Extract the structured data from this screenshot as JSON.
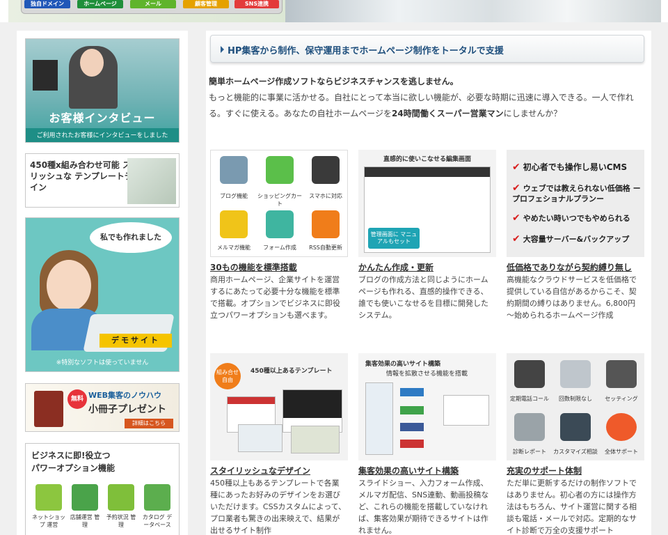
{
  "top_nav": {
    "buttons": [
      {
        "label": "独自ドメイン",
        "color": "#2057b8"
      },
      {
        "label": "ホームページ",
        "color": "#1f8f3a"
      },
      {
        "label": "メール",
        "color": "#5fb42c"
      },
      {
        "label": "顧客管理",
        "color": "#e5a100"
      },
      {
        "label": "SNS連携",
        "color": "#e33b3b"
      }
    ]
  },
  "sidebar": {
    "interview": {
      "title": "お客様インタビュー",
      "subtitle": "ご利用されたお客様にインタビューをしました"
    },
    "templates": {
      "text": "450種x組み合わせ可能 スタイリッシュな テンプレートデザイン"
    },
    "demo": {
      "speech": "私でも作れました",
      "button": "デモサイト",
      "note": "※特別なソフトは使っていません"
    },
    "booklet": {
      "badge": "無料",
      "line1": "WEB集客のノウハウ",
      "line2": "小冊子プレゼント",
      "more": "詳細はこちら"
    },
    "options": {
      "title_line1": "ビジネスに即!役立つ",
      "title_line2": "パワーオプション機能",
      "items": [
        {
          "label": "ネットショップ 運営",
          "color": "#8cc63f"
        },
        {
          "label": "店舗運営 管理",
          "color": "#4aa34a"
        },
        {
          "label": "予約状況 管理",
          "color": "#7fbf3a"
        },
        {
          "label": "カタログ データベース",
          "color": "#5cae4e"
        }
      ]
    }
  },
  "main": {
    "headline": "HP集客から制作、保守運用までホームページ制作をトータルで支援",
    "intro": {
      "lead": "簡単ホームページ作成ソフトならビジネスチャンスを逃しません。",
      "body1": "もっと機能的に事業に活かせる。自社にとって本当に欲しい機能が、必要な時期に迅速に導入できる。一人で作れる。すぐに使える。あなたの自社ホームページを",
      "emph": "24時間働くスーパー営業マン",
      "body2": "にしませんか？"
    },
    "features": {
      "icons": [
        {
          "label": "ブログ機能",
          "color": "#7a9ab0"
        },
        {
          "label": "ショッピングカート",
          "color": "#5bbf4a"
        },
        {
          "label": "スマホに対応",
          "color": "#3a3a3a"
        },
        {
          "label": "メルマガ機能",
          "color": "#f0c419"
        },
        {
          "label": "フォーム作成",
          "color": "#3fb5a0"
        },
        {
          "label": "RSS自動更新",
          "color": "#f07d1a"
        }
      ],
      "title": "30もの機能を標準搭載",
      "desc": "商用ホームページ、企業サイトを運営するにあたって必要十分な機能を標準で搭載。オプションでビジネスに即役立つパワーオプションも選べます。"
    },
    "editor": {
      "caption": "直感的に使いこなせる編集画面",
      "badge": "管理画面に マニュアルもセット",
      "title": "かんたん作成・更新",
      "desc": "ブログの作成方法と同じようにホームページも作れる、直感的操作できる、誰でも使いこなせるを目標に開発したシステム。"
    },
    "price": {
      "checks": [
        "初心者でも操作し易いCMS",
        "ウェブでは教えられない低価格 ープロフェショナルプランー",
        "やめたい時いつでもやめられる",
        "大容量サーバー&バックアップ"
      ],
      "title": "低価格でありながら契約縛り無し",
      "desc": "高機能なクラウドサービスを低価格で提供している自信があるからこそ、契約期間の縛りはありません。6,800円～始められるホームページ作成"
    },
    "design": {
      "badge": "組み合せ 自由",
      "caption": "450種以上あるテンプレート",
      "title": "スタイリッシュなデザイン",
      "desc": "450種以上もあるテンプレートで各業種にあったお好みのデザインをお選びいただけます。CSSカスタムによって、プロ業者も驚きの出来映えで、結果が出せるサイト制作"
    },
    "marketing": {
      "caption": "集客効果の高いサイト構築",
      "subcaption": "情報を拡散させる機能を搭載",
      "title": "集客効果の高いサイト構築",
      "desc": "スライドショー、入力フォーム作成、メルマガ配信、SNS連動、動画投稿など、これらの機能を搭載していなければ、集客効果が期待できるサイトは作れません。"
    },
    "support": {
      "icons": [
        {
          "label": "定期電話コール",
          "color": "#444"
        },
        {
          "label": "回数制限なし",
          "color": "#bfc6cc"
        },
        {
          "label": "セッティング",
          "color": "#555"
        },
        {
          "label": "診断レポート",
          "color": "#9aa3a8"
        },
        {
          "label": "カスタマイズ相談",
          "color": "#3b4a56"
        },
        {
          "label": "全体サポート",
          "color": "#ef5a2a"
        }
      ],
      "title": "充実のサポート体制",
      "desc": "ただ単に更新するだけの制作ソフトではありません。初心者の方には操作方法はもちろん、サイト運営に関する相談も電話・メールで対応。定期的なサイト診断で万全の支援サポート"
    }
  }
}
